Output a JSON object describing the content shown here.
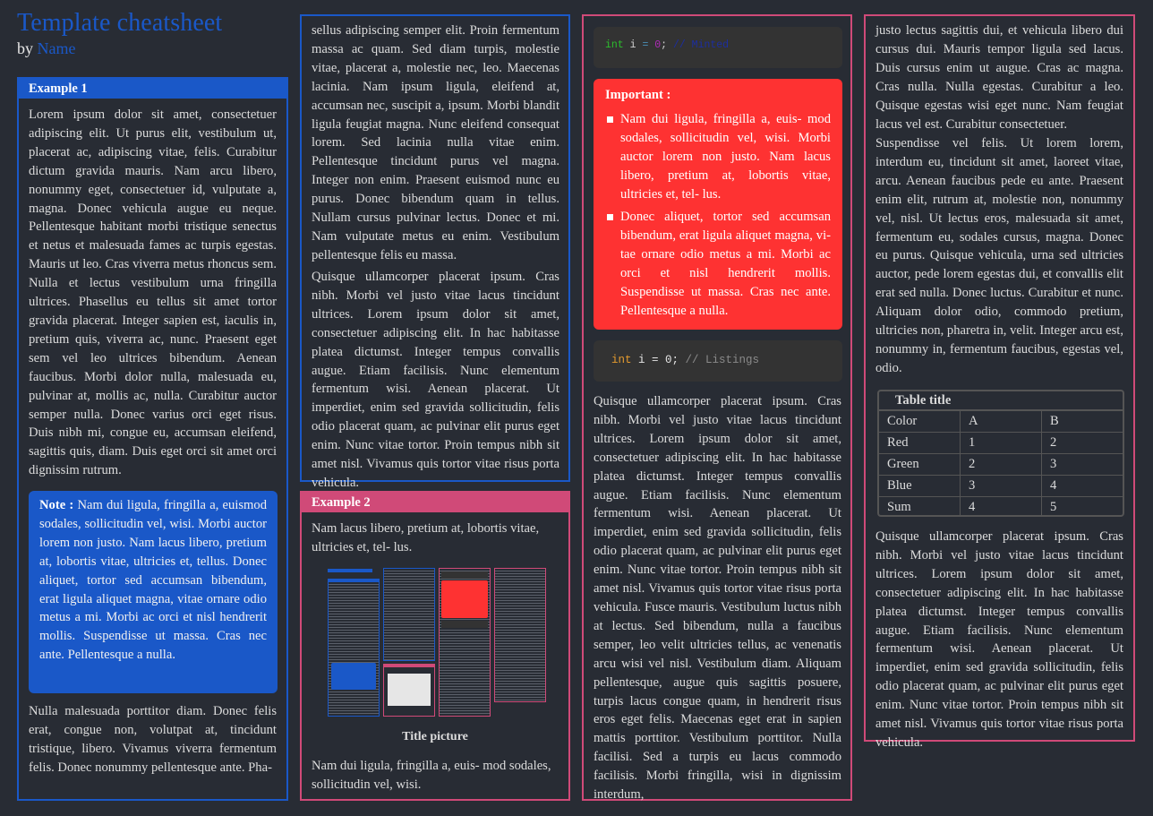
{
  "header": {
    "title": "Template cheatsheet",
    "by": "by",
    "author": "Name"
  },
  "colors": {
    "background": "#282c34",
    "blue_accent": "#1a58c8",
    "pink_accent": "#d04a78",
    "important_red": "#fe3232",
    "code_bg": "#333333"
  },
  "column1": {
    "example1": {
      "title": "Example 1",
      "para1": "Lorem ipsum dolor sit amet, consectetuer adipiscing elit. Ut purus elit, vestibulum ut, placerat ac, adipiscing vitae, felis. Curabitur dictum gravida mauris. Nam arcu libero, nonummy eget, consectetuer id, vulputate a, magna. Donec vehicula augue eu neque. Pellentesque habitant morbi tristique senectus et netus et malesuada fames ac turpis egestas. Mauris ut leo. Cras viverra metus rhoncus sem. Nulla et lectus vestibulum urna fringilla ultrices. Phasellus eu tellus sit amet tortor gravida placerat. Integer sapien est, iaculis in, pretium quis, viverra ac, nunc. Praesent eget sem vel leo ultrices bibendum. Aenean faucibus. Morbi dolor nulla, malesuada eu, pulvinar at, mollis ac, nulla. Curabitur auctor semper nulla. Donec varius orci eget risus. Duis nibh mi, congue eu, accumsan eleifend, sagittis quis, diam. Duis eget orci sit amet orci dignissim rutrum.",
      "note_label": "Note :",
      "note_text": "Nam dui ligula, fringilla a, euismod sodales, sollicitudin vel, wisi. Morbi auctor lorem non justo. Nam lacus libero, pretium at, lobortis vitae, ultricies et, tellus. Donec aliquet, tortor sed accumsan bibendum, erat ligula aliquet magna, vitae ornare odio metus a mi. Morbi ac orci et nisl hendrerit mollis. Suspendisse ut massa. Cras nec ante. Pellentesque a nulla.",
      "para2": "Nulla malesuada porttitor diam. Donec felis erat, congue non, volutpat at, tincidunt tristique, libero. Vivamus viverra fermentum felis. Donec nonummy pellentesque ante. Pha-"
    }
  },
  "column2": {
    "continued": {
      "para1": "sellus adipiscing semper elit. Proin fermentum massa ac quam. Sed diam turpis, molestie vitae, placerat a, molestie nec, leo. Maecenas lacinia. Nam ipsum ligula, eleifend at, accumsan nec, suscipit a, ipsum. Morbi blandit ligula feugiat magna. Nunc eleifend consequat lorem. Sed lacinia nulla vitae enim. Pellentesque tincidunt purus vel magna. Integer non enim. Praesent euismod nunc eu purus. Donec bibendum quam in tellus. Nullam cursus pulvinar lectus. Donec et mi. Nam vulputate metus eu enim. Vestibulum pellentesque felis eu massa.",
      "para2": "Quisque ullamcorper placerat ipsum. Cras nibh. Morbi vel justo vitae lacus tincidunt ultrices. Lorem ipsum dolor sit amet, consectetuer adipiscing elit. In hac habitasse platea dictumst. Integer tempus convallis augue. Etiam facilisis. Nunc elementum fermentum wisi. Aenean placerat. Ut imperdiet, enim sed gravida sollicitudin, felis odio placerat quam, ac pulvinar elit purus eget enim. Nunc vitae tortor. Proin tempus nibh sit amet nisl. Vivamus quis tortor vitae risus porta vehicula."
    },
    "example2": {
      "title": "Example 2",
      "intro": "Nam lacus libero, pretium at, lobortis vitae, ultricies et, tel- lus.",
      "picture_caption": "Title picture",
      "outro": "Nam dui ligula, fringilla a, euis- mod sodales, sollicitudin vel, wisi."
    }
  },
  "column3": {
    "minted": {
      "kw": "int",
      "var": " i ",
      "op": "=",
      "num": " 0",
      "semi": ";",
      "comment": " // Minted"
    },
    "important": {
      "label": "Important :",
      "items": [
        "Nam dui ligula, fringilla a, euis- mod sodales, sollicitudin vel, wisi. Morbi auctor lorem non justo. Nam lacus libero, pretium at, lobortis vitae, ultricies et, tel- lus.",
        "Donec aliquet, tortor sed accumsan bibendum, erat ligula aliquet magna, vi- tae ornare odio metus a mi. Morbi ac orci et nisl hendrerit mollis. Suspendisse ut massa. Cras nec ante. Pellentesque a nulla."
      ]
    },
    "listings": {
      "kw": "int",
      "rest": " i = 0;",
      "comment": " // Listings"
    },
    "para": "Quisque ullamcorper placerat ipsum. Cras nibh. Morbi vel justo vitae lacus tincidunt ultrices. Lorem ipsum dolor sit amet, consectetuer adipiscing elit. In hac habitasse platea dictumst. Integer tempus convallis augue. Etiam facilisis. Nunc elementum fermentum wisi. Aenean placerat. Ut imperdiet, enim sed gravida sollicitudin, felis odio placerat quam, ac pulvinar elit purus eget enim. Nunc vitae tortor. Proin tempus nibh sit amet nisl. Vivamus quis tortor vitae risus porta vehicula. Fusce mauris. Vestibulum luctus nibh at lectus. Sed bibendum, nulla a faucibus semper, leo velit ultricies tellus, ac venenatis arcu wisi vel nisl. Vestibulum diam. Aliquam pellentesque, augue quis sagittis posuere, turpis lacus congue quam, in hendrerit risus eros eget felis. Maecenas eget erat in sapien mattis porttitor. Vestibulum porttitor. Nulla facilisi. Sed a turpis eu lacus commodo facilisis. Morbi fringilla, wisi in dignissim interdum,"
  },
  "column4": {
    "para1": "justo lectus sagittis dui, et vehicula libero dui cursus dui. Mauris tempor ligula sed lacus. Duis cursus enim ut augue. Cras ac magna. Cras nulla. Nulla egestas. Curabitur a leo. Quisque egestas wisi eget nunc. Nam feugiat lacus vel est. Curabitur consectetuer.",
    "para2": "Suspendisse vel felis. Ut lorem lorem, interdum eu, tincidunt sit amet, laoreet vitae, arcu. Aenean faucibus pede eu ante. Praesent enim elit, rutrum at, molestie non, nonummy vel, nisl. Ut lectus eros, malesuada sit amet, fermentum eu, sodales cursus, magna. Donec eu purus. Quisque vehicula, urna sed ultricies auctor, pede lorem egestas dui, et convallis elit erat sed nulla. Donec luctus. Curabitur et nunc. Aliquam dolor odio, commodo pretium, ultricies non, pharetra in, velit. Integer arcu est, nonummy in, fermentum faucibus, egestas vel, odio.",
    "table": {
      "title": "Table title",
      "header": [
        "Color",
        "A",
        "B"
      ],
      "rows": [
        [
          "Red",
          "1",
          "2"
        ],
        [
          "Green",
          "2",
          "3"
        ],
        [
          "Blue",
          "3",
          "4"
        ],
        [
          "Sum",
          "4",
          "5"
        ]
      ]
    },
    "para3": "Quisque ullamcorper placerat ipsum. Cras nibh. Morbi vel justo vitae lacus tincidunt ultrices. Lorem ipsum dolor sit amet, consectetuer adipiscing elit. In hac habitasse platea dictumst. Integer tempus convallis augue. Etiam facilisis. Nunc elementum fermentum wisi. Aenean placerat. Ut imperdiet, enim sed gravida sollicitudin, felis odio placerat quam, ac pulvinar elit purus eget enim. Nunc vitae tortor. Proin tempus nibh sit amet nisl. Vivamus quis tortor vitae risus porta vehicula."
  }
}
